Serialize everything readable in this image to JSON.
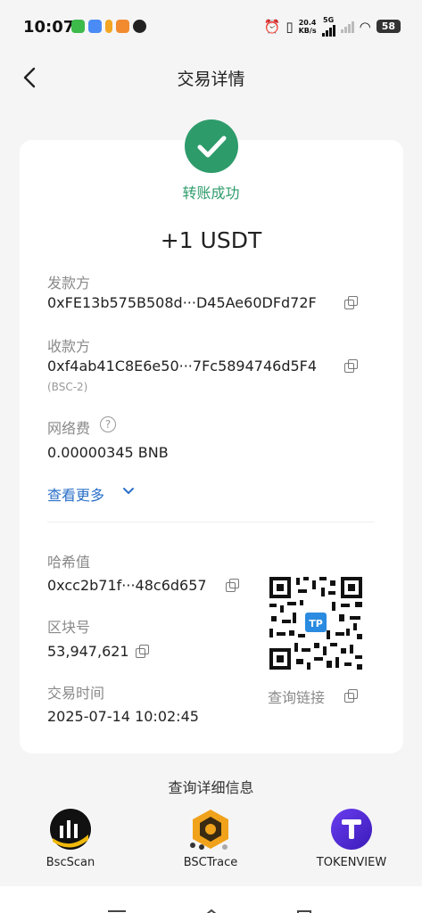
{
  "status_bar": {
    "time": "10:07",
    "speed_value": "20.4",
    "speed_unit": "KB/s",
    "network": "5G",
    "battery": "58"
  },
  "header": {
    "title": "交易详情"
  },
  "transaction": {
    "status": "转账成功",
    "amount": "+1 USDT",
    "from_label": "发款方",
    "from_address": "0xFE13b575B508d···D45Ae60DFd72F",
    "to_label": "收款方",
    "to_address": "0xf4ab41C8E6e50···7Fc5894746d5F4",
    "to_network": "(BSC-2)",
    "fee_label": "网络费",
    "fee_value": "0.00000345 BNB",
    "more_label": "查看更多",
    "hash_label": "哈希值",
    "hash_value": "0xcc2b71f···48c6d657",
    "block_label": "区块号",
    "block_value": "53,947,621",
    "time_label": "交易时间",
    "time_value": "2025-07-14 10:02:45",
    "qr_link_label": "查询链接"
  },
  "explorers": {
    "title": "查询详细信息",
    "items": [
      {
        "name": "BscScan"
      },
      {
        "name": "BSCTrace"
      },
      {
        "name": "TOKENVIEW"
      }
    ]
  },
  "colors": {
    "success": "#2e9b6b",
    "link": "#2b6fc9"
  }
}
